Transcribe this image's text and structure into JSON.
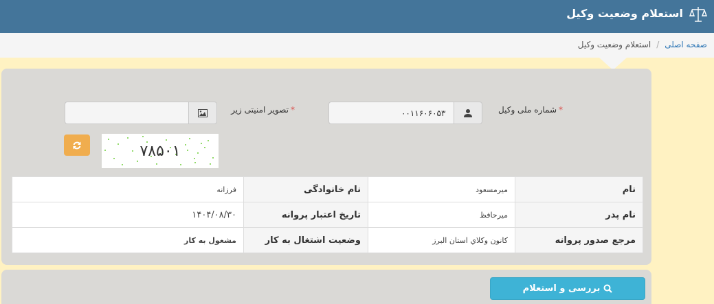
{
  "header": {
    "title": "استعلام وضعیت وکیل",
    "logo_icon": "scales-of-justice-icon"
  },
  "breadcrumb": {
    "home": "صفحه اصلی",
    "separator": "/",
    "current": "استعلام وضعیت وکیل"
  },
  "form": {
    "national_id": {
      "label": "شماره ملی وکیل",
      "required_mark": "*",
      "value": "۰۰۱۱۶۰۶۰۵۳",
      "icon": "user-icon"
    },
    "captcha_input": {
      "label": "تصویر امنیتی زیر",
      "required_mark": "*",
      "value": "",
      "icon": "image-icon"
    },
    "captcha": {
      "text": "۷۸۵۰۱",
      "refresh_icon": "refresh-icon"
    }
  },
  "result": {
    "rows": [
      {
        "k1": "نام",
        "v1": "میرمسعود",
        "k2": "نام خانوادگی",
        "v2": "فرزانه"
      },
      {
        "k1": "نام پدر",
        "v1": "میرحافظ",
        "k2": "تاریخ اعتبار پروانه",
        "v2": "۱۴۰۴/۰۸/۳۰"
      },
      {
        "k1": "مرجع صدور پروانه",
        "v1": "کانون وکلاي استان البرز",
        "k2": "وضعیت اشتغال به کار",
        "v2": "مشغول به کار"
      }
    ]
  },
  "actions": {
    "submit": "بررسی و استعلام",
    "submit_icon": "search-icon"
  },
  "colors": {
    "header": "#44759a",
    "page_bg": "#fff2c2",
    "panel": "#dad9d6",
    "submit": "#3eb3d6",
    "refresh": "#f0ad4e"
  }
}
